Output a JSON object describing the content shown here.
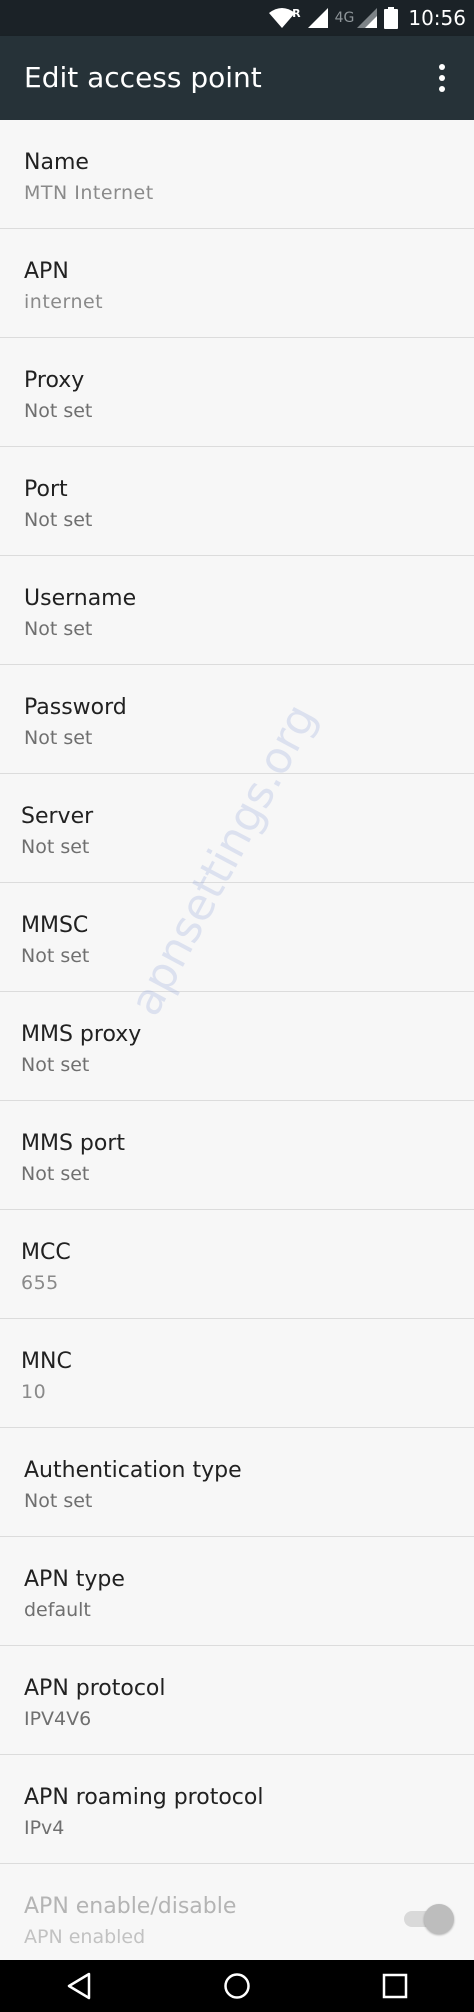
{
  "status_bar": {
    "clock": "10:56",
    "network_label": "4G",
    "roaming_label": "R",
    "icons": [
      "wifi-icon",
      "signal-icon",
      "signal-icon",
      "battery-icon"
    ]
  },
  "app_bar": {
    "title": "Edit access point",
    "menu_icon": "more-vert-icon"
  },
  "settings": [
    {
      "title": "Name",
      "summary": "MTN Internet"
    },
    {
      "title": "APN",
      "summary": "internet"
    },
    {
      "title": "Proxy",
      "summary": "Not set"
    },
    {
      "title": "Port",
      "summary": "Not set"
    },
    {
      "title": "Username",
      "summary": "Not set"
    },
    {
      "title": "Password",
      "summary": "Not set"
    },
    {
      "title": "Server",
      "summary": "Not set"
    },
    {
      "title": "MMSC",
      "summary": "Not set"
    },
    {
      "title": "MMS proxy",
      "summary": "Not set"
    },
    {
      "title": "MMS port",
      "summary": "Not set"
    },
    {
      "title": "MCC",
      "summary": "655"
    },
    {
      "title": "MNC",
      "summary": "10"
    },
    {
      "title": "Authentication type",
      "summary": "Not set"
    },
    {
      "title": "APN type",
      "summary": "default"
    },
    {
      "title": "APN protocol",
      "summary": "IPV4V6"
    },
    {
      "title": "APN roaming protocol",
      "summary": "IPv4"
    },
    {
      "title": "APN enable/disable",
      "summary": "APN enabled",
      "toggle_on": true,
      "enabled": false
    }
  ],
  "watermark": "apnsettings.org",
  "nav_bar": {
    "icons": [
      "back-icon",
      "home-icon",
      "recents-icon"
    ]
  },
  "colors": {
    "status_bar": "#1b2227",
    "app_bar": "#263238",
    "background": "#f7f7f7",
    "divider": "#dcdcdc"
  }
}
